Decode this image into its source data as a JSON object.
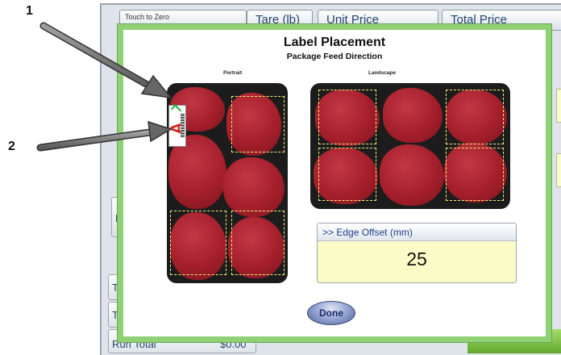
{
  "background": {
    "headers": [
      "Touch to Zero",
      "Tare (lb)",
      "Unit Price",
      "Total Price"
    ],
    "side_button_letter": "E",
    "row_label_1": "T",
    "row_label_2": "T",
    "run_total_label": "Run Total",
    "run_total_value": "$0.00"
  },
  "modal": {
    "title": "Label Placement",
    "subtitle": "Package Feed Direction",
    "portrait_label": "Portrait",
    "landscape_label": "Landscape",
    "edge_offset_label": ">> Edge Offset (mm)",
    "edge_offset_value": "25",
    "done_label": "Done",
    "label_letter": "A"
  },
  "callouts": [
    "1",
    "2"
  ],
  "colors": {
    "modal_border": "#8fd174",
    "slot_border": "#f2ee7a",
    "meat": "#a41f2b",
    "offset_bg": "#fbfbc8",
    "label_letter": "#d81e1e"
  }
}
